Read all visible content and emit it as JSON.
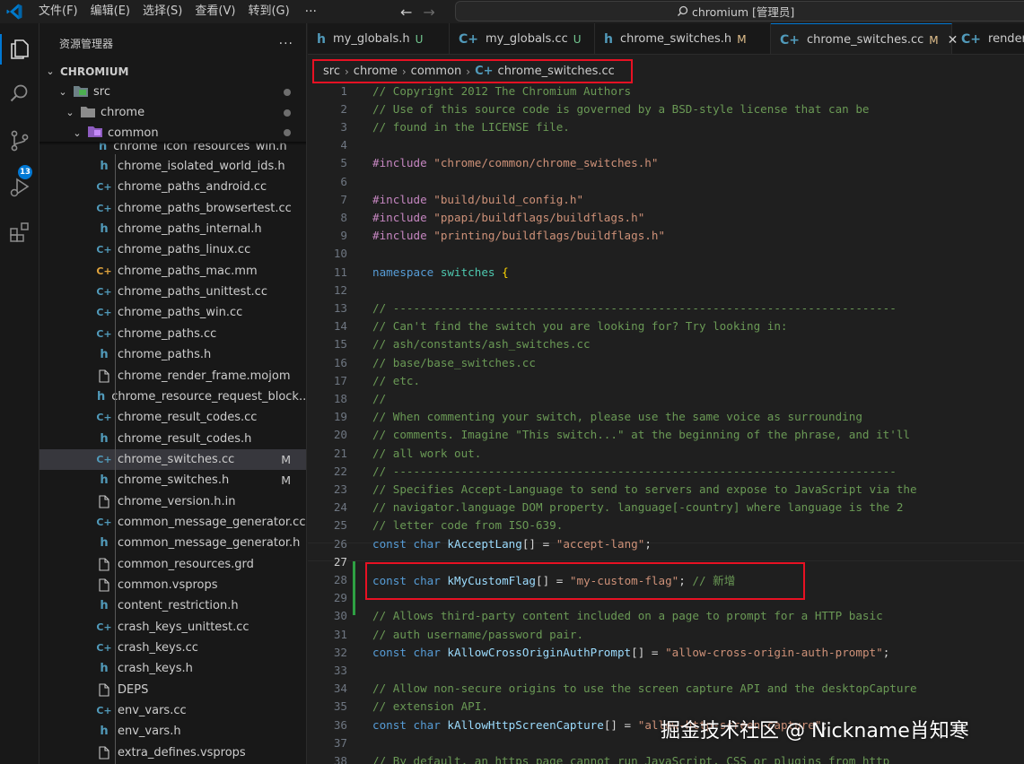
{
  "titlebar": {
    "menus": [
      "文件(F)",
      "编辑(E)",
      "选择(S)",
      "查看(V)",
      "转到(G)"
    ],
    "more": "···",
    "back_arrow": "←",
    "forward_arrow": "→",
    "search_text": "chromium [管理员]"
  },
  "activitybar": {
    "icons": [
      "explorer-icon",
      "search-icon",
      "source-control-icon",
      "run-debug-icon",
      "extensions-icon"
    ],
    "scm_badge": "13",
    "accent_color": "#0078d4"
  },
  "sidebar": {
    "title": "资源管理器",
    "more": "···",
    "root": "CHROMIUM",
    "folders": [
      {
        "label": "src",
        "chevron": "⌄"
      },
      {
        "label": "chrome",
        "chevron": "⌄"
      },
      {
        "label": "common",
        "chevron": "⌄"
      }
    ],
    "partial_item": "chrome_icon_resources_win.h",
    "files": [
      {
        "label": "chrome_isolated_world_ids.h",
        "type": "h",
        "status": ""
      },
      {
        "label": "chrome_paths_android.cc",
        "type": "cc",
        "status": ""
      },
      {
        "label": "chrome_paths_browsertest.cc",
        "type": "cc",
        "status": ""
      },
      {
        "label": "chrome_paths_internal.h",
        "type": "h",
        "status": ""
      },
      {
        "label": "chrome_paths_linux.cc",
        "type": "cc",
        "status": ""
      },
      {
        "label": "chrome_paths_mac.mm",
        "type": "mm",
        "status": ""
      },
      {
        "label": "chrome_paths_unittest.cc",
        "type": "cc",
        "status": ""
      },
      {
        "label": "chrome_paths_win.cc",
        "type": "cc",
        "status": ""
      },
      {
        "label": "chrome_paths.cc",
        "type": "cc",
        "status": ""
      },
      {
        "label": "chrome_paths.h",
        "type": "h",
        "status": ""
      },
      {
        "label": "chrome_render_frame.mojom",
        "type": "doc",
        "status": ""
      },
      {
        "label": "chrome_resource_request_block...",
        "type": "h",
        "status": ""
      },
      {
        "label": "chrome_result_codes.cc",
        "type": "cc",
        "status": ""
      },
      {
        "label": "chrome_result_codes.h",
        "type": "h",
        "status": ""
      },
      {
        "label": "chrome_switches.cc",
        "type": "cc",
        "status": "M",
        "selected": true
      },
      {
        "label": "chrome_switches.h",
        "type": "h",
        "status": "M"
      },
      {
        "label": "chrome_version.h.in",
        "type": "doc",
        "status": ""
      },
      {
        "label": "common_message_generator.cc",
        "type": "cc",
        "status": ""
      },
      {
        "label": "common_message_generator.h",
        "type": "h",
        "status": ""
      },
      {
        "label": "common_resources.grd",
        "type": "doc",
        "status": ""
      },
      {
        "label": "common.vsprops",
        "type": "doc",
        "status": ""
      },
      {
        "label": "content_restriction.h",
        "type": "h",
        "status": ""
      },
      {
        "label": "crash_keys_unittest.cc",
        "type": "cc",
        "status": ""
      },
      {
        "label": "crash_keys.cc",
        "type": "cc",
        "status": ""
      },
      {
        "label": "crash_keys.h",
        "type": "h",
        "status": ""
      },
      {
        "label": "DEPS",
        "type": "doc",
        "status": ""
      },
      {
        "label": "env_vars.cc",
        "type": "cc",
        "status": ""
      },
      {
        "label": "env_vars.h",
        "type": "h",
        "status": ""
      },
      {
        "label": "extra_defines.vsprops",
        "type": "doc",
        "status": ""
      }
    ]
  },
  "tabs": [
    {
      "label": "my_globals.h",
      "icon": "h",
      "status": "U",
      "active": false
    },
    {
      "label": "my_globals.cc",
      "icon": "cc",
      "status": "U",
      "active": false
    },
    {
      "label": "chrome_switches.h",
      "icon": "h",
      "status": "M",
      "active": false
    },
    {
      "label": "chrome_switches.cc",
      "icon": "cc",
      "status": "M",
      "active": true,
      "close": "✕"
    },
    {
      "label": "render_",
      "icon": "cc",
      "status": "",
      "active": false
    }
  ],
  "breadcrumb": {
    "parts": [
      "src",
      "chrome",
      "common"
    ],
    "file": "chrome_switches.cc",
    "separator": "›"
  },
  "editor": {
    "current_line": 27,
    "lines": [
      {
        "n": "1",
        "t": [
          [
            "c",
            "// Copyright 2012 The Chromium Authors"
          ]
        ]
      },
      {
        "n": "2",
        "t": [
          [
            "c",
            "// Use of this source code is governed by a BSD-style license that can be"
          ]
        ]
      },
      {
        "n": "3",
        "t": [
          [
            "c",
            "// found in the LICENSE file."
          ]
        ]
      },
      {
        "n": "4",
        "t": []
      },
      {
        "n": "5",
        "t": [
          [
            "p",
            "#include "
          ],
          [
            "s",
            "\"chrome/common/chrome_switches.h\""
          ]
        ]
      },
      {
        "n": "6",
        "t": []
      },
      {
        "n": "7",
        "t": [
          [
            "p",
            "#include "
          ],
          [
            "s",
            "\"build/build_config.h\""
          ]
        ]
      },
      {
        "n": "8",
        "t": [
          [
            "p",
            "#include "
          ],
          [
            "s",
            "\"ppapi/buildflags/buildflags.h\""
          ]
        ]
      },
      {
        "n": "9",
        "t": [
          [
            "p",
            "#include "
          ],
          [
            "s",
            "\"printing/buildflags/buildflags.h\""
          ]
        ]
      },
      {
        "n": "10",
        "t": []
      },
      {
        "n": "11",
        "t": [
          [
            "k",
            "namespace "
          ],
          [
            "n",
            "switches "
          ],
          [
            "b",
            "{"
          ]
        ]
      },
      {
        "n": "12",
        "t": []
      },
      {
        "n": "13",
        "t": [
          [
            "c",
            "// --------------------------------------------------------------------------"
          ]
        ]
      },
      {
        "n": "14",
        "t": [
          [
            "c",
            "// Can't find the switch you are looking for? Try looking in:"
          ]
        ]
      },
      {
        "n": "15",
        "t": [
          [
            "c",
            "// ash/constants/ash_switches.cc"
          ]
        ]
      },
      {
        "n": "16",
        "t": [
          [
            "c",
            "// base/base_switches.cc"
          ]
        ]
      },
      {
        "n": "17",
        "t": [
          [
            "c",
            "// etc."
          ]
        ]
      },
      {
        "n": "18",
        "t": [
          [
            "c",
            "//"
          ]
        ]
      },
      {
        "n": "19",
        "t": [
          [
            "c",
            "// When commenting your switch, please use the same voice as surrounding"
          ]
        ]
      },
      {
        "n": "20",
        "t": [
          [
            "c",
            "// comments. Imagine \"This switch...\" at the beginning of the phrase, and it'll"
          ]
        ]
      },
      {
        "n": "21",
        "t": [
          [
            "c",
            "// all work out."
          ]
        ]
      },
      {
        "n": "22",
        "t": [
          [
            "c",
            "// --------------------------------------------------------------------------"
          ]
        ]
      },
      {
        "n": "23",
        "t": [
          [
            "c",
            "// Specifies Accept-Language to send to servers and expose to JavaScript via the"
          ]
        ]
      },
      {
        "n": "24",
        "t": [
          [
            "c",
            "// navigator.language DOM property. language[-country] where language is the 2"
          ]
        ]
      },
      {
        "n": "25",
        "t": [
          [
            "c",
            "// letter code from ISO-639."
          ]
        ]
      },
      {
        "n": "26",
        "t": [
          [
            "k",
            "const "
          ],
          [
            "k",
            "char "
          ],
          [
            "i",
            "kAcceptLang"
          ],
          [
            "o",
            "[] = "
          ],
          [
            "s",
            "\"accept-lang\""
          ],
          [
            "o",
            ";"
          ]
        ]
      },
      {
        "n": "27",
        "t": []
      },
      {
        "n": "28",
        "t": [
          [
            "k",
            "const "
          ],
          [
            "k",
            "char "
          ],
          [
            "i",
            "kMyCustomFlag"
          ],
          [
            "o",
            "[] = "
          ],
          [
            "s",
            "\"my-custom-flag\""
          ],
          [
            "o",
            "; "
          ],
          [
            "c",
            "// 新增"
          ]
        ]
      },
      {
        "n": "29",
        "t": []
      },
      {
        "n": "30",
        "t": [
          [
            "c",
            "// Allows third-party content included on a page to prompt for a HTTP basic"
          ]
        ]
      },
      {
        "n": "31",
        "t": [
          [
            "c",
            "// auth username/password pair."
          ]
        ]
      },
      {
        "n": "32",
        "t": [
          [
            "k",
            "const "
          ],
          [
            "k",
            "char "
          ],
          [
            "i",
            "kAllowCrossOriginAuthPrompt"
          ],
          [
            "o",
            "[] = "
          ],
          [
            "s",
            "\"allow-cross-origin-auth-prompt\""
          ],
          [
            "o",
            ";"
          ]
        ]
      },
      {
        "n": "33",
        "t": []
      },
      {
        "n": "34",
        "t": [
          [
            "c",
            "// Allow non-secure origins to use the screen capture API and the desktopCapture"
          ]
        ]
      },
      {
        "n": "35",
        "t": [
          [
            "c",
            "// extension API."
          ]
        ]
      },
      {
        "n": "36",
        "t": [
          [
            "k",
            "const "
          ],
          [
            "k",
            "char "
          ],
          [
            "i",
            "kAllowHttpScreenCapture"
          ],
          [
            "o",
            "[] = "
          ],
          [
            "s",
            "\"allow-http-screen-capture\""
          ],
          [
            "o",
            ";"
          ]
        ]
      },
      {
        "n": "37",
        "t": []
      },
      {
        "n": "38",
        "t": [
          [
            "c",
            "// By default, an https page cannot run JavaScript, CSS or plugins from http"
          ]
        ]
      }
    ]
  },
  "watermark": "掘金技术社区 @ Nickname肖知寒"
}
